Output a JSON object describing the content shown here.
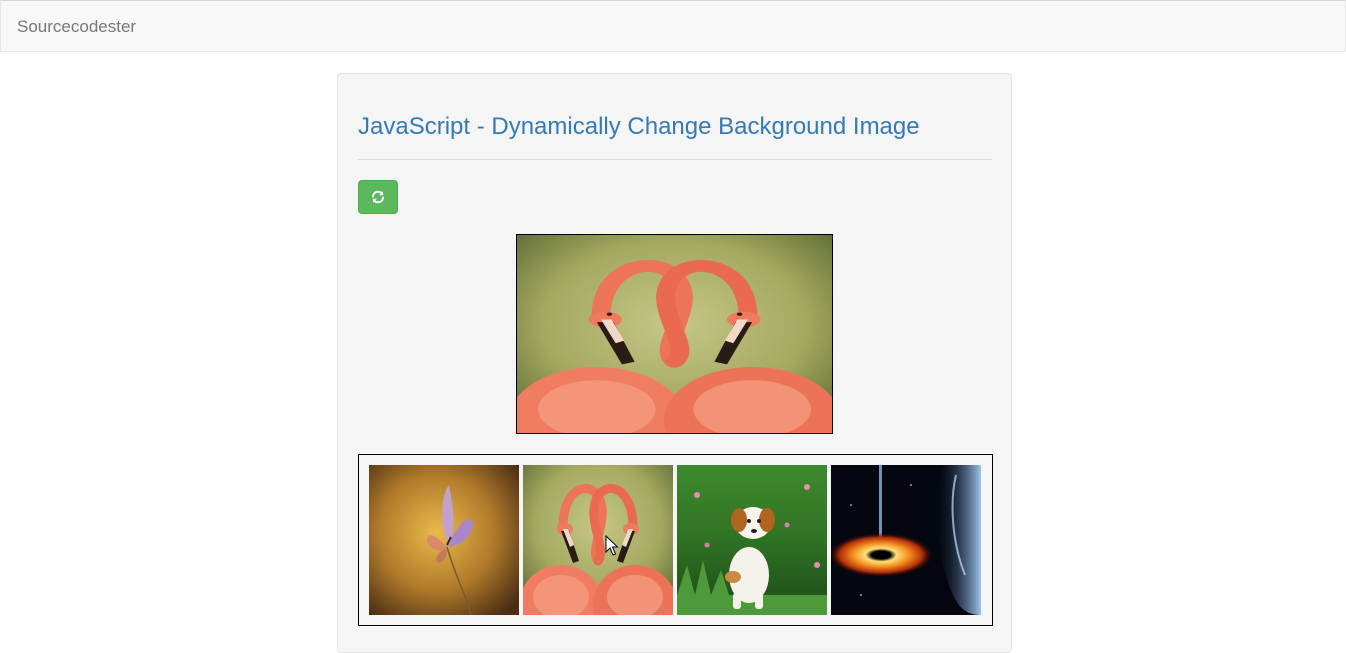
{
  "navbar": {
    "brand": "Sourcecodester"
  },
  "content": {
    "title": "JavaScript - Dynamically Change Background Image",
    "refresh_icon": "refresh-icon"
  },
  "main_image": {
    "subject": "flamingos"
  },
  "thumbnails": [
    {
      "subject": "butterfly"
    },
    {
      "subject": "flamingos"
    },
    {
      "subject": "puppy"
    },
    {
      "subject": "black-hole"
    }
  ],
  "colors": {
    "accent": "#337ab7",
    "button": "#5cb85c",
    "well": "#f5f5f5"
  }
}
